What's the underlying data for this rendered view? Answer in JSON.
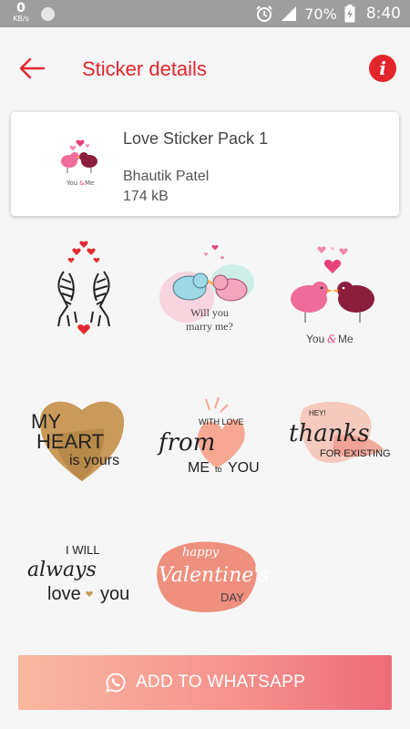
{
  "status_bar": {
    "net_speed_value": "0",
    "net_speed_unit": "KB/s",
    "battery": "70%",
    "time": "8:40",
    "icons": [
      "alarm-icon",
      "signal-icon",
      "battery-charging-icon"
    ]
  },
  "toolbar": {
    "title": "Sticker details",
    "back_icon": "arrow-left-icon",
    "info_icon": "info-icon"
  },
  "pack": {
    "name": "Love Sticker Pack 1",
    "author": "Bhautik Patel",
    "size": "174 kB",
    "thumb_text_you": "You",
    "thumb_text_me": "Me"
  },
  "stickers": [
    {
      "name": "zebra-hearts-sticker"
    },
    {
      "name": "will-you-marry-me-sticker",
      "lines": [
        "Will you",
        "marry me?"
      ]
    },
    {
      "name": "you-and-me-birds-sticker",
      "lines": [
        "You",
        "Me"
      ]
    },
    {
      "name": "my-heart-is-yours-sticker",
      "lines": [
        "MY",
        "HEART",
        "is yours"
      ]
    },
    {
      "name": "with-love-from-me-to-you-sticker",
      "lines": [
        "WITH LOVE",
        "from",
        "ME",
        "to",
        "YOU"
      ]
    },
    {
      "name": "thanks-for-existing-sticker",
      "lines": [
        "HEY!",
        "thanks",
        "FOR EXISTING"
      ]
    },
    {
      "name": "i-will-always-love-you-sticker",
      "lines": [
        "I WILL",
        "always",
        "love",
        "you"
      ]
    },
    {
      "name": "happy-valentines-day-sticker",
      "lines": [
        "happy",
        "Valentine's",
        "DAY"
      ]
    }
  ],
  "button": {
    "label": "ADD TO WHATSAPP",
    "icon": "whatsapp-icon"
  },
  "colors": {
    "accent": "#e3262b",
    "button_start": "#f9b8a0",
    "button_end": "#ee6b78"
  }
}
